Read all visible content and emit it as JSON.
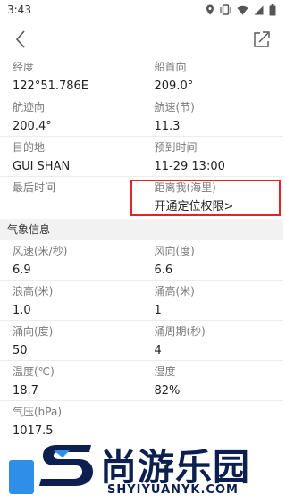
{
  "status_bar": {
    "time": "3:43"
  },
  "nav": {
    "back_icon": "chevron-left-icon",
    "share_icon": "share-icon"
  },
  "ship_info": [
    {
      "label": "经度",
      "value": "122°51.786E"
    },
    {
      "label": "船首向",
      "value": "209.0°"
    },
    {
      "label": "航迹向",
      "value": "200.4°"
    },
    {
      "label": "航速(节)",
      "value": "11.3"
    },
    {
      "label": "目的地",
      "value": "GUI SHAN"
    },
    {
      "label": "预到时间",
      "value": "11-29 13:00"
    },
    {
      "label": "最后时间",
      "value": ""
    },
    {
      "label": "距离我(海里)",
      "value": "开通定位权限>"
    }
  ],
  "weather": {
    "section_title": "气象信息",
    "items": [
      {
        "label": "风速(米/秒)",
        "value": "6.9"
      },
      {
        "label": "风向(度)",
        "value": "6.6"
      },
      {
        "label": "浪高(米)",
        "value": "1.0"
      },
      {
        "label": "涌高(米)",
        "value": "1"
      },
      {
        "label": "涌向(度)",
        "value": "50"
      },
      {
        "label": "涌周期(秒)",
        "value": "4"
      },
      {
        "label": "温度(℃)",
        "value": "18.7"
      },
      {
        "label": "湿度",
        "value": "82%"
      },
      {
        "label": "气压(hPa)",
        "value": "1017.5"
      }
    ]
  },
  "watermark": {
    "title": "尚游乐园",
    "subtitle": "SHYIYUANYK.COM"
  },
  "colors": {
    "highlight_border": "#e0242b",
    "section_bg": "#f2f2f2",
    "watermark_blue": "#2f8fe8",
    "watermark_navy": "#0c1f4f"
  }
}
